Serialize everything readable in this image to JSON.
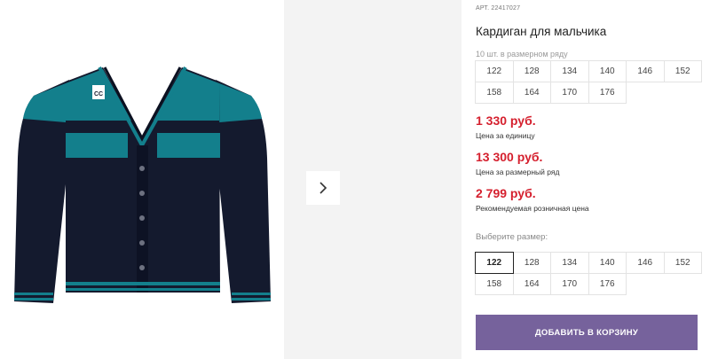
{
  "product": {
    "article": "АРТ. 22417027",
    "title": "Кардиган для мальчика",
    "size_row_caption": "10 шт. в размерном ряду",
    "size_row": [
      "122",
      "128",
      "134",
      "140",
      "146",
      "152",
      "158",
      "164",
      "170",
      "176"
    ]
  },
  "prices": [
    {
      "value": "1 330 руб.",
      "note": "Цена за единицу"
    },
    {
      "value": "13 300 руб.",
      "note": "Цена за размерный ряд"
    },
    {
      "value": "2 799 руб.",
      "note": "Рекомендуемая розничная цена"
    }
  ],
  "size_select": {
    "label": "Выберите размер:",
    "options": [
      "122",
      "128",
      "134",
      "140",
      "146",
      "152",
      "158",
      "164",
      "170",
      "176"
    ],
    "selected": "122"
  },
  "cart": {
    "add_label": "ДОБАВИТЬ В КОРЗИНУ"
  },
  "gallery": {
    "next_icon": "chevron-right-icon",
    "logo_text": "CC"
  },
  "colors": {
    "price": "#d5202e",
    "button": "#76629c",
    "cardigan_body": "#141a2e",
    "cardigan_accent": "#137f8c"
  }
}
